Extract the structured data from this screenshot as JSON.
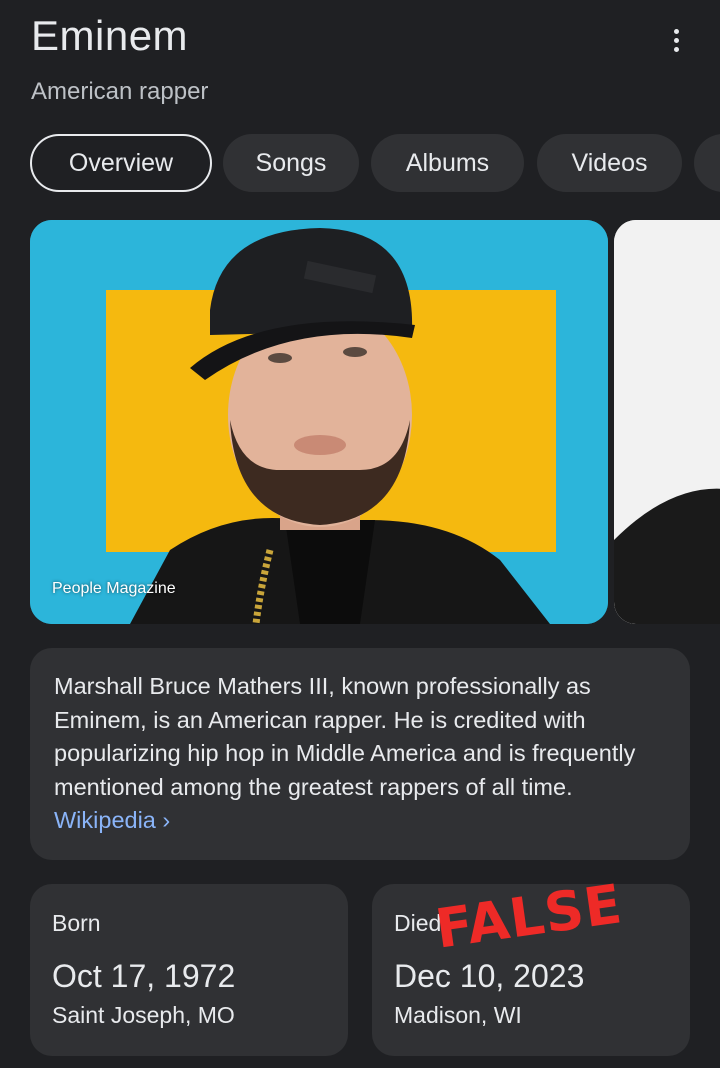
{
  "header": {
    "title": "Eminem",
    "subtitle": "American rapper",
    "more_icon": "more-vert-icon"
  },
  "tabs": [
    {
      "label": "Overview",
      "active": true
    },
    {
      "label": "Songs",
      "active": false
    },
    {
      "label": "Albums",
      "active": false
    },
    {
      "label": "Videos",
      "active": false
    }
  ],
  "image": {
    "credit": "People Magazine"
  },
  "description": {
    "text": "Marshall Bruce Mathers III, known professionally as Eminem, is an American rapper. He is credited with popularizing hip hop in Middle America and is frequently mentioned among the greatest rappers of all time.",
    "link_label": "Wikipedia ›"
  },
  "facts": {
    "born": {
      "label": "Born",
      "value": "Oct 17, 1972",
      "place": "Saint Joseph, MO"
    },
    "died": {
      "label": "Died",
      "value": "Dec 10, 2023",
      "place": "Madison, WI"
    }
  },
  "overlay": {
    "stamp_text": "FALSE"
  },
  "colors": {
    "background": "#1f2023",
    "card": "#303134",
    "link": "#8ab4f8",
    "stamp": "#ee2a27"
  }
}
